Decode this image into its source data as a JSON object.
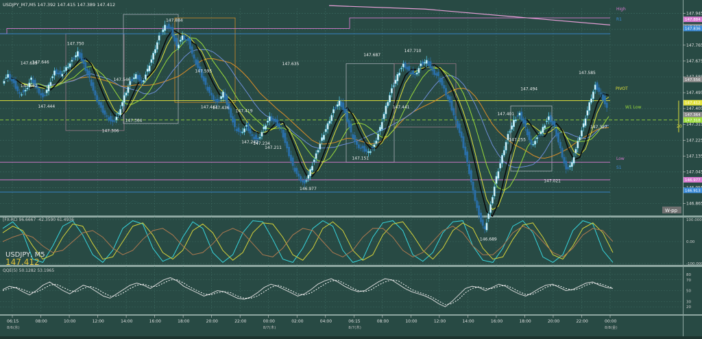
{
  "header": {
    "symbol_line": "USDJPY_M7,M5  147.392 147.415 147.389 147.412"
  },
  "symbol_label": "USDJPY, M5",
  "current_price": "147.412",
  "colors": {
    "background": "#284a44",
    "grid": "#3c6a61",
    "candle_up": "#55c8e8",
    "candle_down": "#2a6fa8",
    "ema_black": "#0a0a0a",
    "ma_yellow": "#e2e23a",
    "ma_green": "#9bdc3a",
    "ma_orange": "#d28a2a",
    "ma_blue": "#6f8fd8",
    "pink": "#d87ad0",
    "rci_cyan": "#38d8e0",
    "rci_yellow": "#d8d43a",
    "rci_brown": "#b07a50",
    "qqe_solid": "#d8d8d8",
    "qqe_dotted": "#ffffff"
  },
  "level_labels": {
    "high": "High",
    "r1": "R1",
    "pivot": "PIVOT",
    "w1_low": "W1 Low",
    "low": "Low",
    "s1": "S1",
    "w_pp": "W-pp",
    "twenty": "20"
  },
  "chart_data": [
    {
      "type": "line",
      "name": "price",
      "y_ticks": [
        "147.945",
        "147.855",
        "147.765",
        "147.675",
        "147.585",
        "147.495",
        "147.405",
        "147.315",
        "147.225",
        "147.135",
        "147.045",
        "146.955",
        "146.865"
      ],
      "ylim": [
        146.805,
        147.975
      ],
      "x_ticks": [
        "06:15",
        "08:00",
        "10:00",
        "12:00",
        "14:00",
        "16:00",
        "18:00",
        "20:00",
        "22:00",
        "00:00",
        "02:00",
        "04:00",
        "06:15",
        "08:00",
        "10:00",
        "12:00",
        "14:00",
        "16:00",
        "18:00",
        "20:00",
        "22:00",
        "00:00"
      ],
      "x_date_labels": [
        {
          "label": "8/6(水)",
          "at": 0
        },
        {
          "label": "8/7(木)",
          "at": 9
        },
        {
          "label": "8/7(木)",
          "at": 12
        },
        {
          "label": "8/8(金)",
          "at": 21
        }
      ],
      "close_path": [
        147.56,
        147.6,
        147.55,
        147.49,
        147.51,
        147.58,
        147.52,
        147.47,
        147.54,
        147.62,
        147.6,
        147.64,
        147.68,
        147.73,
        147.66,
        147.58,
        147.48,
        147.41,
        147.36,
        147.33,
        147.38,
        147.48,
        147.56,
        147.6,
        147.55,
        147.63,
        147.72,
        147.82,
        147.88,
        147.86,
        147.76,
        147.82,
        147.79,
        147.69,
        147.62,
        147.54,
        147.48,
        147.44,
        147.5,
        147.4,
        147.3,
        147.27,
        147.31,
        147.25,
        147.23,
        147.3,
        147.36,
        147.33,
        147.29,
        147.18,
        147.08,
        147.02,
        146.98,
        147.06,
        147.15,
        147.24,
        147.32,
        147.4,
        147.45,
        147.38,
        147.27,
        147.2,
        147.18,
        147.16,
        147.2,
        147.3,
        147.42,
        147.52,
        147.6,
        147.66,
        147.62,
        147.6,
        147.66,
        147.68,
        147.62,
        147.59,
        147.52,
        147.44,
        147.34,
        147.24,
        147.1,
        146.94,
        146.8,
        146.72,
        146.86,
        147.02,
        147.14,
        147.26,
        147.34,
        147.38,
        147.3,
        147.2,
        147.24,
        147.3,
        147.36,
        147.3,
        147.18,
        147.06,
        147.1,
        147.22,
        147.32,
        147.44,
        147.54,
        147.49,
        147.41
      ],
      "highs": [
        {
          "x": 4,
          "price": "147.639"
        },
        {
          "x": 6,
          "price": "147.646"
        },
        {
          "x": 12,
          "price": "147.750"
        },
        {
          "x": 29,
          "price": "147.884"
        },
        {
          "x": 49,
          "price": "147.635"
        },
        {
          "x": 63,
          "price": "147.687"
        },
        {
          "x": 70,
          "price": "147.710"
        },
        {
          "x": 90,
          "price": "147.494"
        },
        {
          "x": 100,
          "price": "147.585"
        },
        {
          "x": 34,
          "price": "147.595"
        },
        {
          "x": 20,
          "price": "147.546"
        }
      ],
      "lows": [
        {
          "x": 4,
          "price": "147.562"
        },
        {
          "x": 7,
          "price": "147.444"
        },
        {
          "x": 18,
          "price": "147.306"
        },
        {
          "x": 22,
          "price": "147.364"
        },
        {
          "x": 35,
          "price": "147.441"
        },
        {
          "x": 37,
          "price": "147.436"
        },
        {
          "x": 42,
          "price": "147.242"
        },
        {
          "x": 44,
          "price": "147.234"
        },
        {
          "x": 46,
          "price": "147.211"
        },
        {
          "x": 52,
          "price": "146.977"
        },
        {
          "x": 61,
          "price": "147.151"
        },
        {
          "x": 68,
          "price": "147.441"
        },
        {
          "x": 83,
          "price": "146.689"
        },
        {
          "x": 86,
          "price": "147.401"
        },
        {
          "x": 88,
          "price": "147.255"
        },
        {
          "x": 94,
          "price": "147.021"
        },
        {
          "x": 41,
          "price": "147.419"
        },
        {
          "x": 102,
          "price": "147.327"
        }
      ],
      "right_axis_badges": [
        {
          "price": 147.912,
          "text": "147.884",
          "color": "#d87ad0"
        },
        {
          "price": 147.87,
          "text": "147.855",
          "color": "#8a8a8a"
        },
        {
          "price": 147.86,
          "text": "147.836",
          "color": "#3a8ad8"
        },
        {
          "price": 147.57,
          "text": "147.556",
          "color": "#8a8a8a"
        },
        {
          "price": 147.438,
          "text": "147.412",
          "color": "#e2e23a"
        },
        {
          "price": 147.37,
          "text": "147.364",
          "color": "#8a8a8a"
        },
        {
          "price": 147.34,
          "text": "147.318",
          "color": "#9bdc3a"
        },
        {
          "price": 147.0,
          "text": "146.977",
          "color": "#d87ad0"
        },
        {
          "price": 146.94,
          "text": "146.913",
          "color": "#3a8ad8"
        }
      ]
    },
    {
      "type": "line",
      "name": "rci",
      "legend": "[FX-RCI 96.6667 -42.3590 61.4936",
      "y_ticks": [
        "100.0000",
        "0.00",
        "-100.0000"
      ],
      "ylim": [
        -100,
        100
      ],
      "series": [
        {
          "name": "rci_fast",
          "values": [
            60,
            90,
            40,
            -80,
            -95,
            -20,
            70,
            95,
            30,
            -60,
            -95,
            -40,
            60,
            95,
            80,
            -30,
            -90,
            -70,
            20,
            90,
            60,
            -50,
            -95,
            -60,
            40,
            95,
            90,
            10,
            -80,
            -95,
            -30,
            60,
            95,
            70,
            -40,
            -95,
            -80,
            20,
            85,
            95,
            50,
            -60,
            -90,
            -50,
            40,
            90,
            95,
            -20,
            -85,
            -95,
            -30,
            70,
            95,
            40,
            -70,
            -95,
            -60,
            50,
            95,
            80,
            -40,
            -95
          ]
        },
        {
          "name": "rci_mid",
          "values": [
            40,
            70,
            50,
            -20,
            -80,
            -60,
            20,
            80,
            70,
            -10,
            -80,
            -70,
            0,
            70,
            85,
            30,
            -50,
            -80,
            -40,
            50,
            80,
            40,
            -40,
            -85,
            -50,
            40,
            85,
            80,
            20,
            -60,
            -85,
            -30,
            60,
            90,
            50,
            -40,
            -85,
            -60,
            30,
            80,
            90,
            30,
            -40,
            -80,
            -30,
            50,
            85,
            60,
            -30,
            -80,
            -70,
            10,
            75,
            85,
            20,
            -60,
            -80,
            -20,
            60,
            85,
            40,
            -50
          ]
        },
        {
          "name": "rci_slow",
          "values": [
            0,
            20,
            35,
            20,
            -20,
            -50,
            -40,
            0,
            40,
            50,
            20,
            -30,
            -60,
            -40,
            10,
            50,
            60,
            30,
            -20,
            -60,
            -50,
            -10,
            40,
            60,
            40,
            -10,
            -60,
            -70,
            -30,
            30,
            60,
            50,
            0,
            -50,
            -70,
            -40,
            20,
            60,
            60,
            20,
            -40,
            -70,
            -50,
            0,
            50,
            70,
            40,
            -20,
            -60,
            -60,
            -20,
            40,
            70,
            50,
            0,
            -50,
            -70,
            -30,
            30,
            60,
            50,
            0
          ]
        }
      ]
    },
    {
      "type": "line",
      "name": "qqe",
      "legend": "QQE(5) 50.1282 53.1965",
      "y_ticks": [
        "80",
        "70",
        "50",
        "30",
        "20"
      ],
      "ylim": [
        10,
        90
      ],
      "series": [
        {
          "name": "qqe_line",
          "values": [
            52,
            58,
            55,
            48,
            42,
            50,
            60,
            66,
            58,
            50,
            44,
            52,
            60,
            56,
            48,
            40,
            36,
            44,
            52,
            60,
            64,
            60,
            54,
            62,
            70,
            74,
            68,
            58,
            52,
            46,
            40,
            44,
            50,
            48,
            42,
            36,
            34,
            38,
            46,
            56,
            62,
            58,
            52,
            46,
            40,
            44,
            52,
            62,
            68,
            72,
            66,
            58,
            52,
            48,
            50,
            58,
            66,
            72,
            70,
            62,
            54,
            48,
            44,
            40,
            34,
            26,
            20,
            30,
            42,
            54,
            58,
            56,
            50,
            56,
            62,
            58,
            50,
            44,
            40,
            46,
            54,
            60,
            62,
            56,
            50,
            52,
            58,
            64,
            66,
            60,
            56,
            54
          ]
        },
        {
          "name": "qqe_signal",
          "values": [
            50,
            54,
            56,
            52,
            47,
            47,
            53,
            60,
            62,
            56,
            50,
            48,
            54,
            58,
            54,
            46,
            40,
            40,
            46,
            54,
            60,
            62,
            58,
            58,
            64,
            70,
            70,
            64,
            56,
            50,
            44,
            42,
            46,
            48,
            46,
            40,
            36,
            36,
            40,
            48,
            56,
            60,
            56,
            50,
            44,
            42,
            46,
            54,
            62,
            68,
            69,
            63,
            56,
            50,
            48,
            52,
            60,
            66,
            70,
            68,
            60,
            52,
            47,
            43,
            38,
            31,
            24,
            26,
            34,
            46,
            54,
            57,
            54,
            54,
            58,
            60,
            55,
            48,
            43,
            43,
            49,
            56,
            60,
            59,
            54,
            51,
            54,
            60,
            64,
            63,
            59,
            55
          ]
        }
      ]
    }
  ]
}
